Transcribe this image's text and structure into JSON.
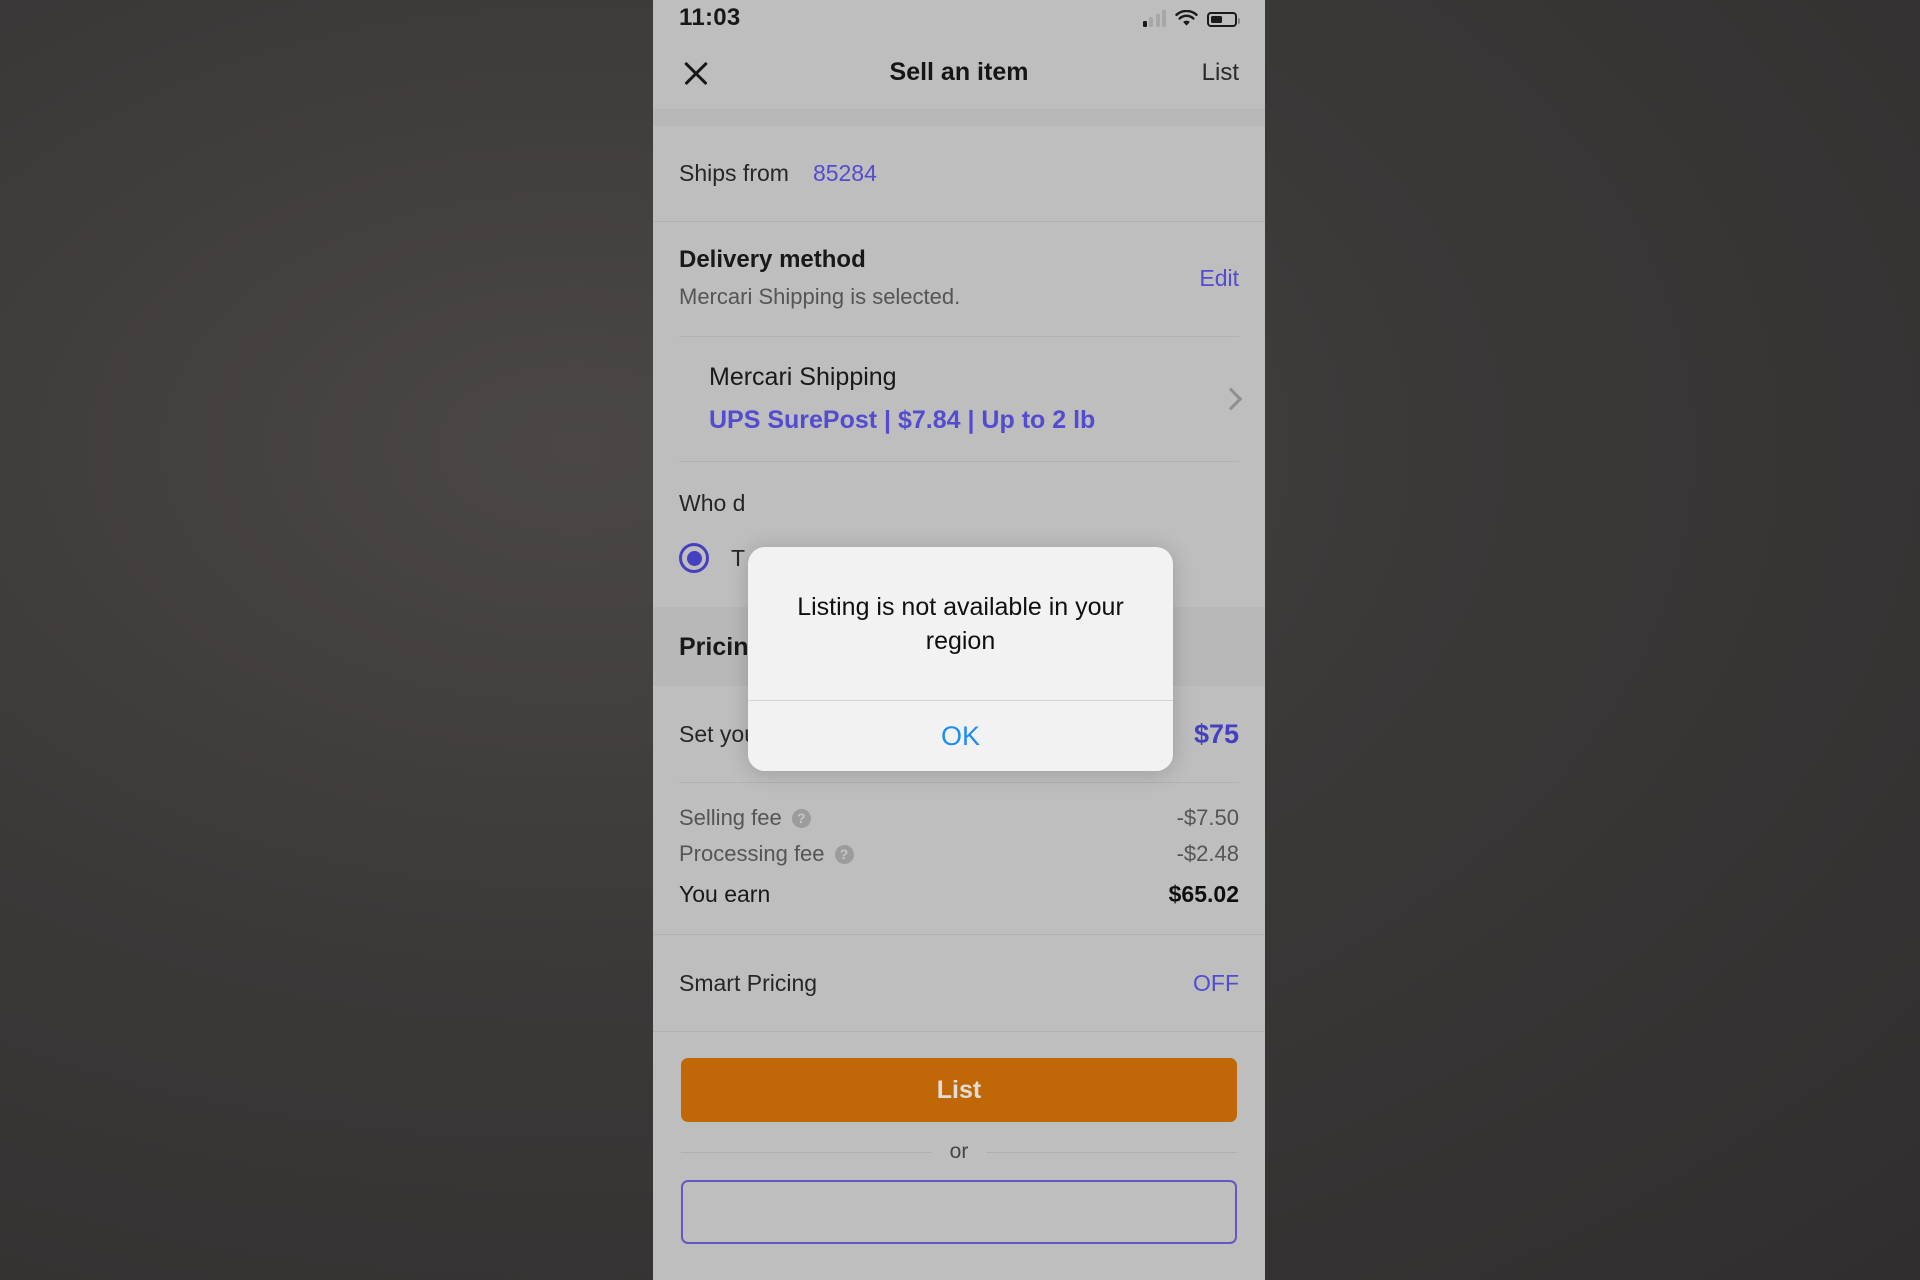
{
  "status_bar": {
    "time": "11:03",
    "signal_icon": "cellular-signal-icon",
    "wifi_icon": "wifi-icon",
    "battery_icon": "battery-icon"
  },
  "nav": {
    "close_icon": "close-icon",
    "title": "Sell an item",
    "action_label": "List"
  },
  "ships_from": {
    "label": "Ships from",
    "value": "85284"
  },
  "delivery_method": {
    "title": "Delivery method",
    "subtitle": "Mercari Shipping is selected.",
    "edit_label": "Edit",
    "carrier_name": "Mercari Shipping",
    "carrier_option": "UPS SurePost | $7.84 | Up to 2 lb",
    "chevron_icon": "chevron-right-icon"
  },
  "who_pays": {
    "question": "Who d",
    "option_label": "T",
    "selected": true
  },
  "pricing": {
    "section_title": "Pricing",
    "set_price_label": "Set your price",
    "set_price_value": "$75",
    "fees": [
      {
        "label": "Selling fee",
        "help_icon": "help-icon",
        "value": "-$7.50"
      },
      {
        "label": "Processing fee",
        "help_icon": "help-icon",
        "value": "-$2.48"
      }
    ],
    "earn_label": "You earn",
    "earn_value": "$65.02",
    "smart_pricing_label": "Smart Pricing",
    "smart_pricing_value": "OFF"
  },
  "footer": {
    "list_button": "List",
    "or_label": "or"
  },
  "alert": {
    "message": "Listing is not available in your region",
    "ok_label": "OK"
  },
  "colors": {
    "accent_purple": "#5a51e0",
    "list_button_orange": "#cf7008",
    "alert_link_blue": "#1f8bf5",
    "screen_bg": "#cdcdcd"
  }
}
